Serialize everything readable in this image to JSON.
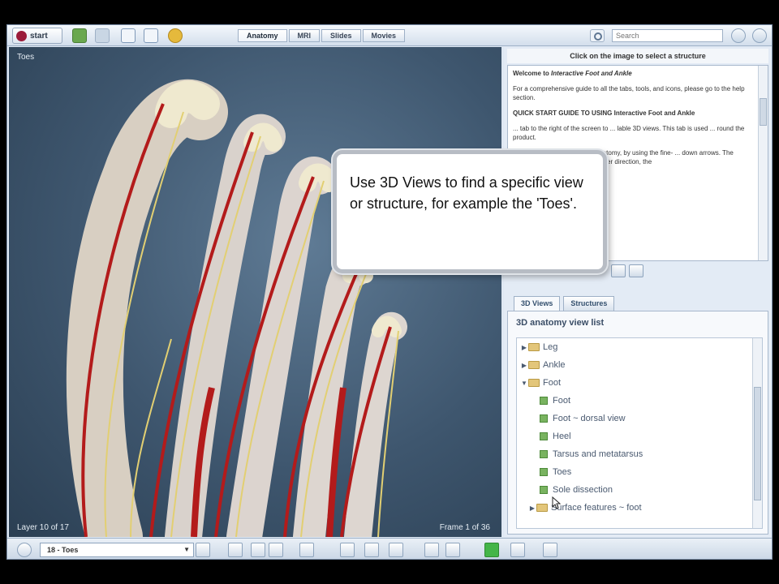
{
  "topbar": {
    "start_label": "start",
    "tabs": [
      {
        "label": "Anatomy",
        "active": true
      },
      {
        "label": "MRI",
        "active": false
      },
      {
        "label": "Slides",
        "active": false
      },
      {
        "label": "Movies",
        "active": false
      }
    ],
    "search_placeholder": "Search"
  },
  "viewer": {
    "title": "Toes",
    "layer_label": "Layer 10 of 17",
    "frame_label": "Frame 1 of 36"
  },
  "info": {
    "header": "Click on the image to select a structure",
    "welcome_prefix": "Welcome to ",
    "welcome_title": "Interactive Foot and Ankle",
    "guide_text": "For a comprehensive guide to all the tabs, tools, and icons, please go to the help section.",
    "quickstart_heading": "QUICK START GUIDE TO USING Interactive Foot and Ankle",
    "para1": "... tab to the right of the screen to ... lable 3D views. This tab is used ... round the product.",
    "para2": "... bottom of the screen ... of anatomy, by using the fine- ... down arrows. The double arrows ... 1 frames in either direction, the"
  },
  "views": {
    "tabs": [
      {
        "label": "3D Views",
        "active": true
      },
      {
        "label": "Structures",
        "active": false
      }
    ],
    "heading": "3D anatomy view list",
    "tree": [
      {
        "label": "Leg",
        "level": 0,
        "type": "folder",
        "expanded": false
      },
      {
        "label": "Ankle",
        "level": 0,
        "type": "folder",
        "expanded": false
      },
      {
        "label": "Foot",
        "level": 0,
        "type": "folder",
        "expanded": true
      },
      {
        "label": "Foot",
        "level": 1,
        "type": "leaf"
      },
      {
        "label": "Foot ~ dorsal view",
        "level": 1,
        "type": "leaf"
      },
      {
        "label": "Heel",
        "level": 1,
        "type": "leaf"
      },
      {
        "label": "Tarsus and metatarsus",
        "level": 1,
        "type": "leaf"
      },
      {
        "label": "Toes",
        "level": 1,
        "type": "leaf"
      },
      {
        "label": "Sole dissection",
        "level": 1,
        "type": "leaf"
      },
      {
        "label": "Surface features ~ foot",
        "level": 1,
        "type": "folder",
        "expanded": false
      }
    ]
  },
  "bottombar": {
    "view_select": "18 - Toes"
  },
  "callout": {
    "text": "Use 3D Views to find a specific view or structure, for example the 'Toes'."
  }
}
